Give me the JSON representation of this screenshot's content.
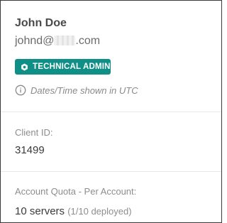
{
  "user": {
    "name": "John Doe",
    "email_prefix": "johnd@",
    "email_suffix": ".com",
    "role_badge": "TECHNICAL ADMIN",
    "role_icon": "hexagon-icon",
    "timezone_note": "Dates/Time shown in UTC",
    "timezone_icon": "info-icon"
  },
  "client": {
    "label": "Client ID:",
    "value": "31499"
  },
  "quota": {
    "label": "Account Quota - Per Account:",
    "value": "10 servers",
    "detail": "(1/10 deployed)"
  },
  "colors": {
    "badge_bg": "#0f8f86",
    "border": "#3a3a3a",
    "divider": "#e8e8e8"
  }
}
